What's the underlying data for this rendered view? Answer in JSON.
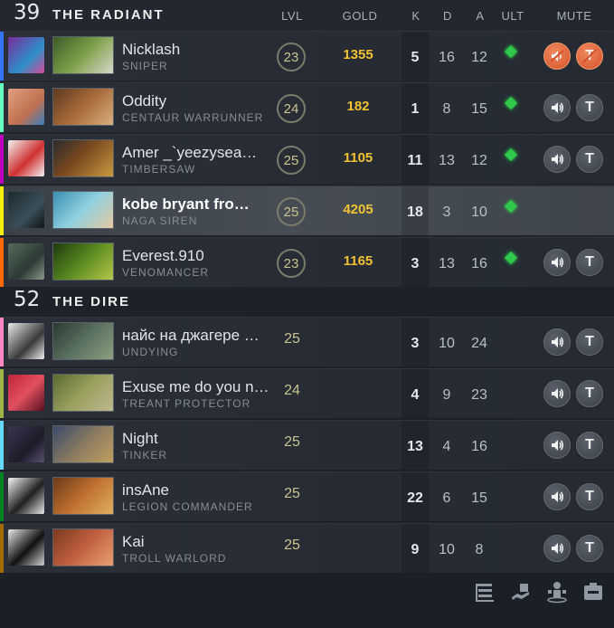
{
  "columns": {
    "lvl": "LVL",
    "gold": "GOLD",
    "k": "K",
    "d": "D",
    "a": "A",
    "ult": "ULT",
    "mute": "MUTE"
  },
  "radiant": {
    "score": "39",
    "name": "THE RADIANT",
    "players": [
      {
        "name": "Nicklash",
        "hero": "SNIPER",
        "level": "23",
        "gold": "1355",
        "k": "5",
        "d": "16",
        "a": "12",
        "ult": true,
        "color": "#3375ff",
        "voice_muted": true,
        "text_muted": true
      },
      {
        "name": "Oddity",
        "hero": "CENTAUR WARRUNNER",
        "level": "24",
        "gold": "182",
        "k": "1",
        "d": "8",
        "a": "15",
        "ult": true,
        "color": "#66ffbf",
        "voice_muted": false,
        "text_muted": false
      },
      {
        "name": "Amer _`yeezysea…",
        "hero": "TIMBERSAW",
        "level": "25",
        "gold": "1105",
        "k": "11",
        "d": "13",
        "a": "12",
        "ult": true,
        "color": "#bf00bf",
        "voice_muted": false,
        "text_muted": false
      },
      {
        "name": "kobe bryant fro…",
        "hero": "NAGA SIREN",
        "level": "25",
        "gold": "4205",
        "k": "18",
        "d": "3",
        "a": "10",
        "ult": true,
        "color": "#f3f00b",
        "self": true
      },
      {
        "name": "Everest.910",
        "hero": "VENOMANCER",
        "level": "23",
        "gold": "1165",
        "k": "3",
        "d": "13",
        "a": "16",
        "ult": true,
        "color": "#ff6b00",
        "voice_muted": false,
        "text_muted": false
      }
    ]
  },
  "dire": {
    "score": "52",
    "name": "THE DIRE",
    "players": [
      {
        "name": "найс на джагере …",
        "hero": "UNDYING",
        "level": "25",
        "k": "3",
        "d": "10",
        "a": "24",
        "color": "#fe86c2"
      },
      {
        "name": "Exuse me do you n…",
        "hero": "TREANT PROTECTOR",
        "level": "24",
        "k": "4",
        "d": "9",
        "a": "23",
        "color": "#a1b447"
      },
      {
        "name": "Night",
        "hero": "TINKER",
        "level": "25",
        "k": "13",
        "d": "4",
        "a": "16",
        "color": "#65d9f7"
      },
      {
        "name": "insAne",
        "hero": "LEGION COMMANDER",
        "level": "25",
        "k": "22",
        "d": "6",
        "a": "15",
        "color": "#008321"
      },
      {
        "name": "Kai",
        "hero": "TROLL WARLORD",
        "level": "25",
        "k": "9",
        "d": "10",
        "a": "8",
        "color": "#a46900"
      }
    ]
  },
  "icons": {
    "voice": "speaker-icon",
    "text": "text-chat-icon",
    "bottom": [
      "scoreboard-list-icon",
      "share-unit-icon",
      "share-hero-icon",
      "disable-help-icon"
    ]
  },
  "colors": {
    "gold": "#f1c232",
    "ult_ready": "#30c84a",
    "muted": "#d6502a"
  }
}
